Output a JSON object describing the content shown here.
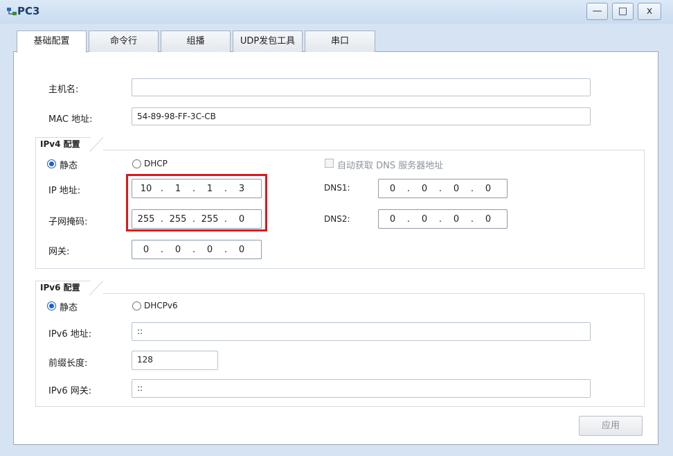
{
  "window": {
    "title": "PC3",
    "icon": "pc-network-icon"
  },
  "tabs": [
    {
      "label": "基础配置"
    },
    {
      "label": "命令行"
    },
    {
      "label": "组播"
    },
    {
      "label": "UDP发包工具"
    },
    {
      "label": "串口"
    }
  ],
  "host": {
    "hostname_label": "主机名:",
    "hostname_value": "",
    "mac_label": "MAC 地址:",
    "mac_value": "54-89-98-FF-3C-CB"
  },
  "ipv4": {
    "title": "IPv4 配置",
    "static_label": "静态",
    "dhcp_label": "DHCP",
    "auto_dns_label": "自动获取 DNS 服务器地址",
    "ip_label": "IP 地址:",
    "ip": [
      "10",
      "1",
      "1",
      "3"
    ],
    "mask_label": "子网掩码:",
    "mask": [
      "255",
      "255",
      "255",
      "0"
    ],
    "gateway_label": "网关:",
    "gateway": [
      "0",
      "0",
      "0",
      "0"
    ],
    "dns1_label": "DNS1:",
    "dns1": [
      "0",
      "0",
      "0",
      "0"
    ],
    "dns2_label": "DNS2:",
    "dns2": [
      "0",
      "0",
      "0",
      "0"
    ]
  },
  "ipv6": {
    "title": "IPv6 配置",
    "static_label": "静态",
    "dhcp_label": "DHCPv6",
    "addr_label": "IPv6 地址:",
    "addr_value": "::",
    "prefix_label": "前缀长度:",
    "prefix_value": "128",
    "gateway_label": "IPv6 网关:",
    "gateway_value": "::"
  },
  "footer": {
    "apply_label": "应用"
  },
  "colors": {
    "highlight": "#e0161b",
    "radio_selected": "#1a62d4",
    "titlebar": "#c9dcf1"
  }
}
